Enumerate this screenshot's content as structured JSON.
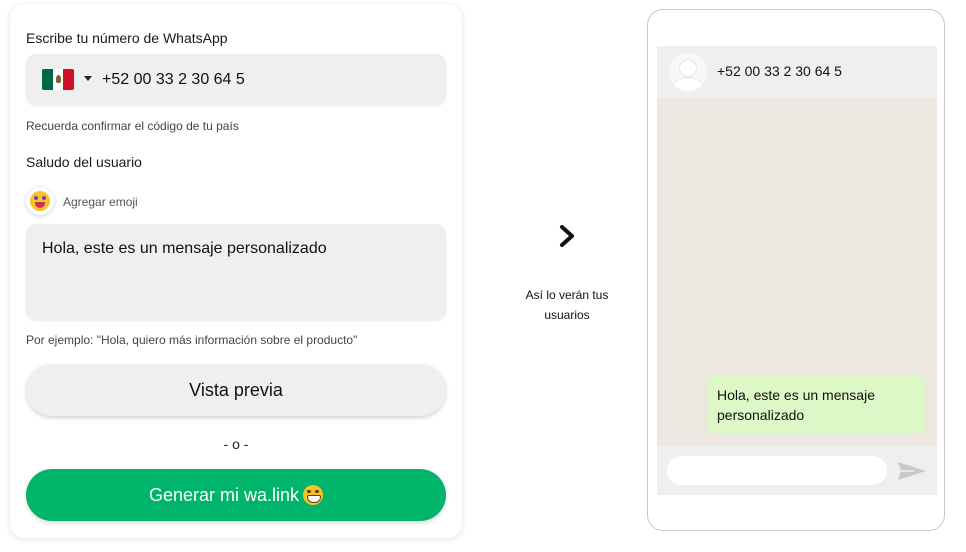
{
  "form": {
    "phone_label": "Escribe tu número de WhatsApp",
    "country_flag": "mexico-flag-icon",
    "phone_value": "+52 00 33 2 30 64 5",
    "phone_hint": "Recuerda confirmar el código de tu país",
    "greeting_label": "Saludo del usuario",
    "emoji_icon": "emoji-face-icon",
    "add_emoji_label": "Agregar emoji",
    "message_value": "Hola, este es un mensaje personalizado",
    "message_hint": "Por ejemplo: \"Hola, quiero más información sobre el producto\"",
    "preview_button": "Vista previa",
    "separator": "- o -",
    "generate_button": "Generar mi wa.link"
  },
  "middle": {
    "arrow_icon": "chevron-right-icon",
    "caption": "Así lo verán tus usuarios"
  },
  "preview": {
    "avatar_icon": "default-avatar-icon",
    "contact": "+52 00 33 2 30 64 5",
    "bubble_text": "Hola, este es un mensaje personalizado",
    "send_icon": "send-icon"
  },
  "colors": {
    "accent_green": "#00b569",
    "bubble_green": "#dcf8c6",
    "chat_background": "#ece8e1",
    "field_gray": "#efefef"
  }
}
